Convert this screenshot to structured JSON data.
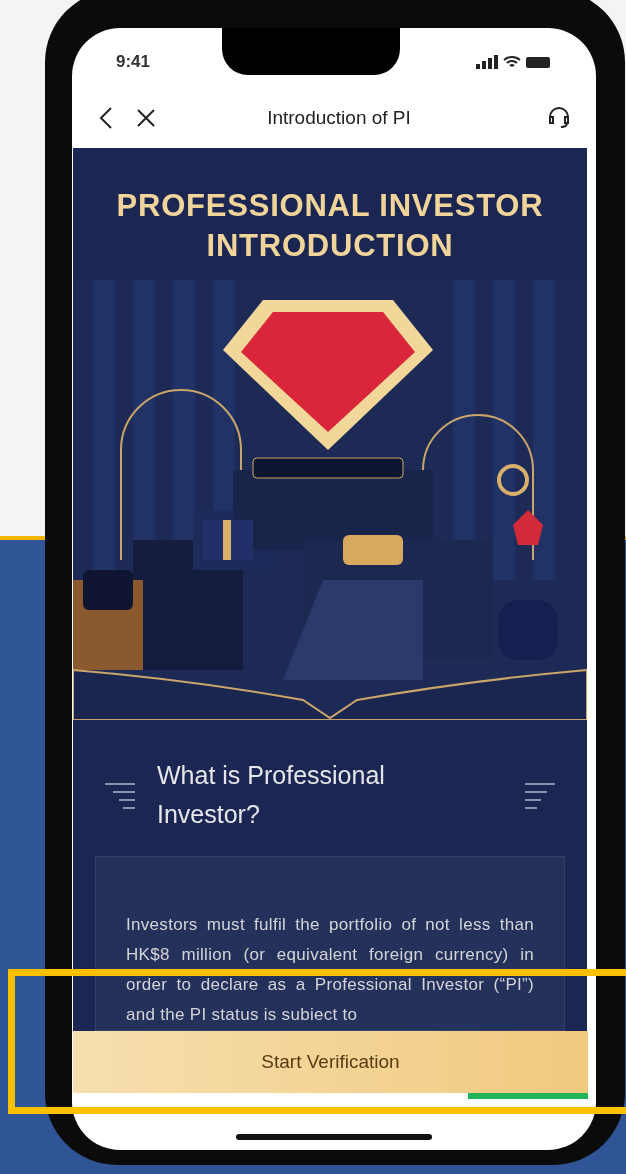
{
  "status_bar": {
    "time": "9:41"
  },
  "nav": {
    "title": "Introduction of PI"
  },
  "hero": {
    "title_lines": [
      "PROFESSIONAL INVESTOR",
      "INTRODUCTION"
    ]
  },
  "section": {
    "heading_lines": [
      "What is Professional",
      "Investor?"
    ],
    "body": "Investors must fulfil the portfolio of not less than HK$8 million (or equivalent foreign currency) in order to declare as a Professional Investor (“PI”) and the PI status is subiect to"
  },
  "button": {
    "label": "Start Verification"
  }
}
